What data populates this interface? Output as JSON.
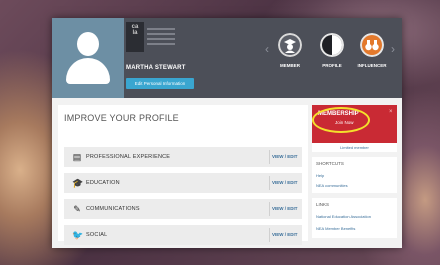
{
  "header": {
    "logo_text": "ca\nla",
    "member_name": "MARTHA STEWART",
    "edit_button": "Edit Personal Information",
    "badges": [
      {
        "label": "MEMBER",
        "icon": "user-hat-icon"
      },
      {
        "label": "PROFILE",
        "icon": "half-circle-icon"
      },
      {
        "label": "INFLUENCER",
        "icon": "binoculars-icon"
      }
    ],
    "nav_prev": "‹",
    "nav_next": "›"
  },
  "main": {
    "title": "IMPROVE YOUR PROFILE",
    "rows": [
      {
        "label": "PROFESSIONAL EXPERIENCE",
        "icon": "document-icon",
        "glyph": "▤",
        "action": "VIEW / EDIT"
      },
      {
        "label": "EDUCATION",
        "icon": "graduation-cap-icon",
        "glyph": "🎓",
        "action": "VIEW / EDIT"
      },
      {
        "label": "COMMUNICATIONS",
        "icon": "pen-icon",
        "glyph": "✎",
        "action": "VIEW / EDIT"
      },
      {
        "label": "SOCIAL",
        "icon": "twitter-icon",
        "glyph": "🐦",
        "action": "VIEW / EDIT"
      }
    ]
  },
  "sidebar": {
    "membership": {
      "title": "MEMBERSHIP",
      "subtitle": "Join Now",
      "close": "×",
      "manage": "Limited member"
    },
    "shortcuts": {
      "title": "SHORTCUTS",
      "links": [
        "Help",
        "NEA communities"
      ]
    },
    "links": {
      "title": "LINKS",
      "links": [
        "National Education Association",
        "NEA Member Benefits"
      ]
    }
  },
  "colors": {
    "header_bg": "#4c4f58",
    "avatar_bg": "#6d8fa4",
    "edit_button": "#3aa6d0",
    "membership_bg": "#c92a34",
    "link": "#3a6f9a",
    "highlight_circle": "#f4e12b"
  }
}
